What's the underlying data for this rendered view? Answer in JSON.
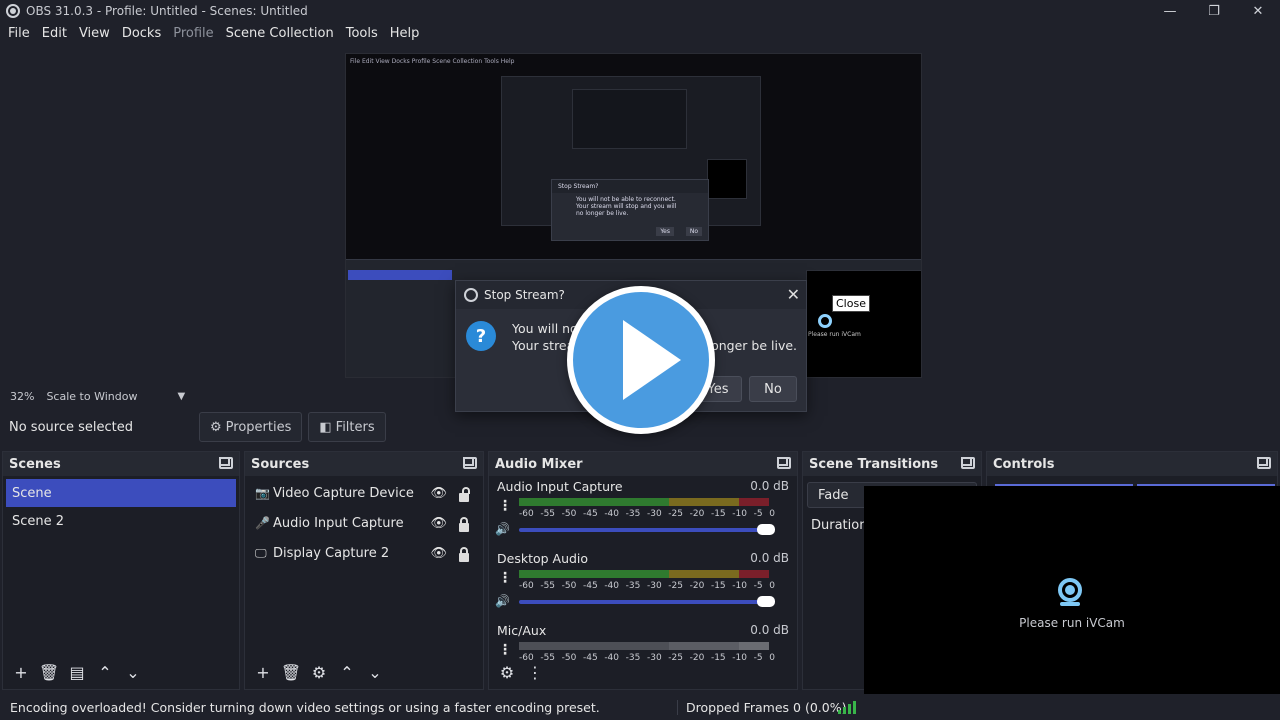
{
  "window": {
    "title": "OBS 31.0.3 - Profile: Untitled - Scenes: Untitled",
    "minimize": "—",
    "maximize": "❐",
    "close": "✕"
  },
  "menu": [
    "File",
    "Edit",
    "View",
    "Docks",
    "Profile",
    "Scene Collection",
    "Tools",
    "Help"
  ],
  "preview": {
    "nested_menu": "File  Edit  View  Docks  Profile  Scene Collection  Tools  Help",
    "nested_dialog_title": "Stop Stream?",
    "nested_dialog_line1": "You will not be able to reconnect.",
    "nested_dialog_line2": "Your stream will stop and you will no longer be live.",
    "nested_yes": "Yes",
    "nested_no": "No",
    "close_tooltip": "Close",
    "ivcam_mini_label": "Please run iVCam"
  },
  "dialog": {
    "title": "Stop Stream?",
    "close": "✕",
    "question": "?",
    "line1": "You will no",
    "line2_start": "Your strea",
    "line2_end": "o longer be live.",
    "yes": "Yes",
    "no": "No"
  },
  "zoom": {
    "value": "32%",
    "mode": "Scale to Window",
    "chevron": "▼"
  },
  "sourcebar": {
    "no_source": "No source selected",
    "properties": "Properties",
    "filters": "Filters",
    "gear": "⚙",
    "filter_icon": "◧"
  },
  "scenes": {
    "title": "Scenes",
    "items": [
      "Scene",
      "Scene 2"
    ],
    "toolbar": [
      "+",
      "🗑",
      "▤",
      "⌃",
      "⌄"
    ]
  },
  "sources": {
    "title": "Sources",
    "items": [
      {
        "icon": "📷",
        "label": "Video Capture Device"
      },
      {
        "icon": "🎤",
        "label": "Audio Input Capture"
      },
      {
        "icon": "🖵",
        "label": "Display Capture 2"
      }
    ],
    "eye": "👁",
    "toolbar": [
      "+",
      "🗑",
      "⚙",
      "⌃",
      "⌄"
    ]
  },
  "mixer": {
    "title": "Audio Mixer",
    "channels": [
      {
        "name": "Audio Input Capture",
        "db": "0.0 dB"
      },
      {
        "name": "Desktop Audio",
        "db": "0.0 dB"
      },
      {
        "name": "Mic/Aux",
        "db": "0.0 dB"
      }
    ],
    "ticks": [
      "-60",
      "-55",
      "-50",
      "-45",
      "-40",
      "-35",
      "-30",
      "-25",
      "-20",
      "-15",
      "-10",
      "-5",
      "0"
    ],
    "dots": "⋮",
    "speaker": "🔊",
    "toolbar": [
      "⚙",
      "⋮"
    ]
  },
  "transitions": {
    "title": "Scene Transitions",
    "selected": "Fade",
    "duration_label": "Duration"
  },
  "controls": {
    "title": "Controls"
  },
  "ivcam": {
    "text": "Please run iVCam"
  },
  "status": {
    "message": "Encoding overloaded! Consider turning down video settings or using a faster encoding preset.",
    "dropped": "Dropped Frames 0 (0.0%)"
  },
  "colors": {
    "accent": "#3c4dbd",
    "meter_green": "#2f7a2f",
    "meter_yellow": "#7a6a1f",
    "meter_red": "#7a1f2a",
    "play_blue": "#4a9be0"
  }
}
